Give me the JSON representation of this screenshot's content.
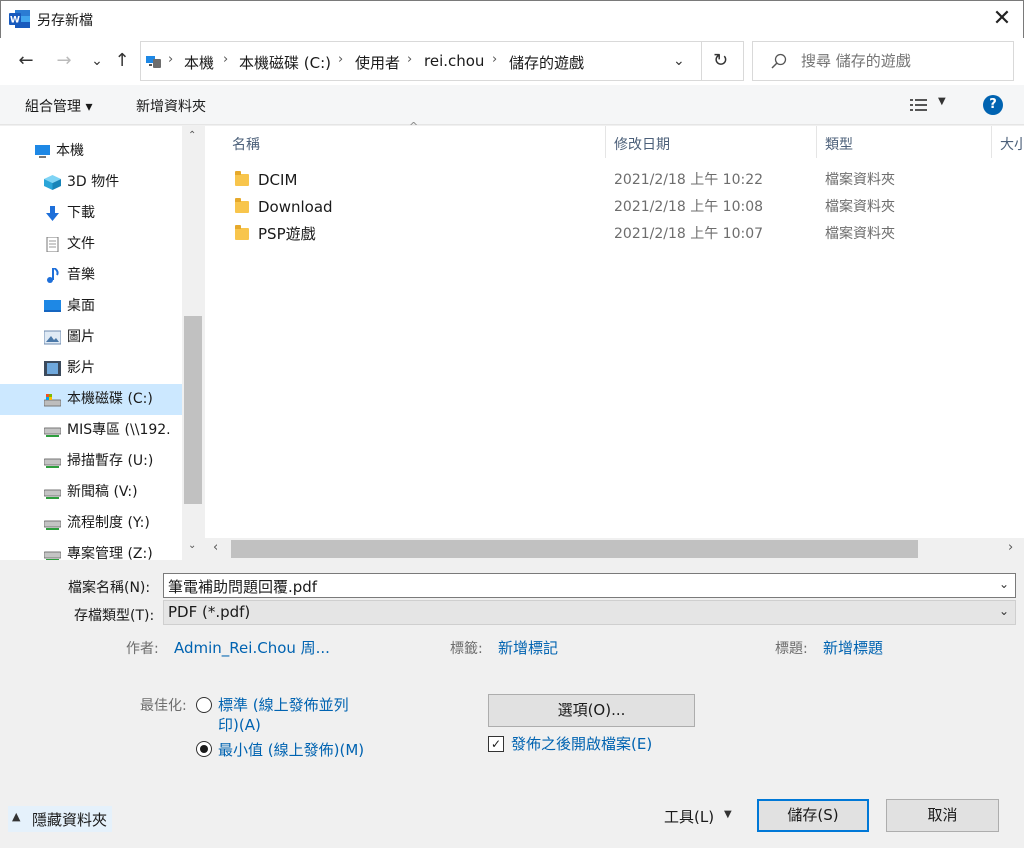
{
  "window": {
    "title": "另存新檔",
    "close_glyph": "✕"
  },
  "nav": {
    "back": "←",
    "forward": "→",
    "recent": "⌄",
    "up": "↑",
    "refresh": "↻"
  },
  "breadcrumb": [
    "本機",
    "本機磁碟 (C:)",
    "使用者",
    "rei.chou",
    "儲存的遊戲"
  ],
  "search": {
    "placeholder": "搜尋 儲存的遊戲"
  },
  "toolbar": {
    "organize": "組合管理 ▾",
    "new_folder": "新增資料夾",
    "help": "?"
  },
  "sidebar": {
    "items": [
      {
        "label": "本機",
        "icon": "pc-icon"
      },
      {
        "label": "3D 物件",
        "icon": "3d-objects-icon"
      },
      {
        "label": "下載",
        "icon": "download-icon"
      },
      {
        "label": "文件",
        "icon": "document-icon"
      },
      {
        "label": "音樂",
        "icon": "music-icon"
      },
      {
        "label": "桌面",
        "icon": "desktop-icon"
      },
      {
        "label": "圖片",
        "icon": "pictures-icon"
      },
      {
        "label": "影片",
        "icon": "videos-icon"
      },
      {
        "label": "本機磁碟 (C:)",
        "icon": "drive-icon",
        "selected": true
      },
      {
        "label": "MIS專區 (\\\\192.",
        "icon": "network-drive-icon"
      },
      {
        "label": "掃描暫存 (U:)",
        "icon": "network-drive-icon"
      },
      {
        "label": "新聞稿 (V:)",
        "icon": "network-drive-icon"
      },
      {
        "label": "流程制度 (Y:)",
        "icon": "network-drive-icon"
      },
      {
        "label": "專案管理 (Z:)",
        "icon": "network-drive-icon"
      }
    ]
  },
  "filelist": {
    "columns": [
      "名稱",
      "修改日期",
      "類型",
      "大小"
    ],
    "rows": [
      {
        "name": "DCIM",
        "date": "2021/2/18 上午 10:22",
        "type": "檔案資料夾"
      },
      {
        "name": "Download",
        "date": "2021/2/18 上午 10:08",
        "type": "檔案資料夾"
      },
      {
        "name": "PSP遊戲",
        "date": "2021/2/18 上午 10:07",
        "type": "檔案資料夾"
      }
    ]
  },
  "form": {
    "filename_label": "檔案名稱(N):",
    "filename_value": "筆電補助問題回覆.pdf",
    "filetype_label": "存檔類型(T):",
    "filetype_value": "PDF (*.pdf)",
    "author_label": "作者:",
    "author_value": "Admin_Rei.Chou 周...",
    "tags_label": "標籤:",
    "tags_value": "新增標記",
    "title_label": "標題:",
    "title_value": "新增標題",
    "optimize_label": "最佳化:",
    "opt_standard_1": "標準 (線上發佈並列",
    "opt_standard_2": "印)(A)",
    "opt_minimum": "最小值 (線上發佈)(M)",
    "options_button": "選項(O)...",
    "open_after_publish": "發佈之後開啟檔案(E)"
  },
  "footer": {
    "hide_folders": "隱藏資料夾",
    "tools": "工具(L)",
    "save": "儲存(S)",
    "cancel": "取消"
  },
  "colors": {
    "accent": "#0078d7",
    "link": "#0063b1",
    "selection": "#cce8ff"
  }
}
